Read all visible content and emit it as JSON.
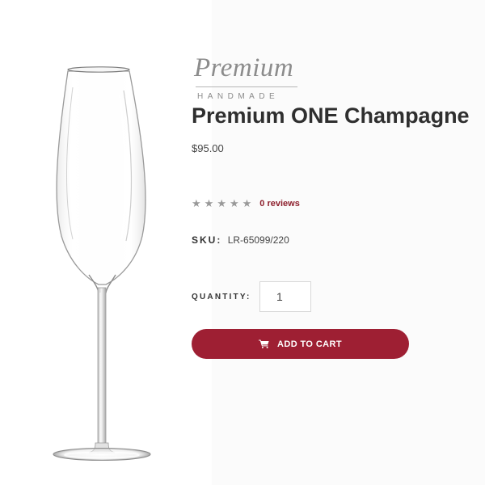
{
  "brand": {
    "script": "Premium",
    "subtitle": "HANDMADE"
  },
  "product": {
    "title": "Premium ONE Champagne",
    "price": "$95.00",
    "rating_stars": 0,
    "rating_max": 5,
    "reviews_label": "0 reviews",
    "sku_label": "SKU:",
    "sku_value": "LR-65099/220",
    "image_icon": "champagne-flute"
  },
  "purchase": {
    "quantity_label": "QUANTITY:",
    "quantity_value": "1",
    "add_to_cart_label": "ADD TO CART",
    "cart_icon": "shopping-cart",
    "button_color": "#9e1f33"
  },
  "colors": {
    "accent": "#9e1f33",
    "reviews_link": "#8d1f2c"
  }
}
